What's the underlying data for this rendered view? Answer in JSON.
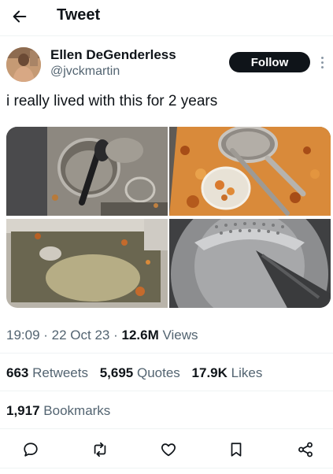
{
  "header": {
    "title": "Tweet",
    "back_icon": "arrow-left-icon"
  },
  "author": {
    "display_name": "Ellen DeGenderless",
    "handle": "@jvckmartin",
    "follow_label": "Follow",
    "more_icon": "more-vertical-icon"
  },
  "tweet": {
    "text": "i really lived with this for 2 years"
  },
  "meta": {
    "time": "19:09",
    "date": "22 Oct 23",
    "views_count": "12.6M",
    "views_label": "Views"
  },
  "stats": {
    "retweets_count": "663",
    "retweets_label": "Retweets",
    "quotes_count": "5,695",
    "quotes_label": "Quotes",
    "likes_count": "17.9K",
    "likes_label": "Likes",
    "bookmarks_count": "1,917",
    "bookmarks_label": "Bookmarks"
  },
  "actions": [
    "reply-icon",
    "retweet-icon",
    "like-icon",
    "bookmark-icon",
    "share-icon"
  ],
  "colors": {
    "text": "#0f1419",
    "secondary": "#536471",
    "divider": "#eff3f4",
    "follow_bg": "#0f1419"
  }
}
